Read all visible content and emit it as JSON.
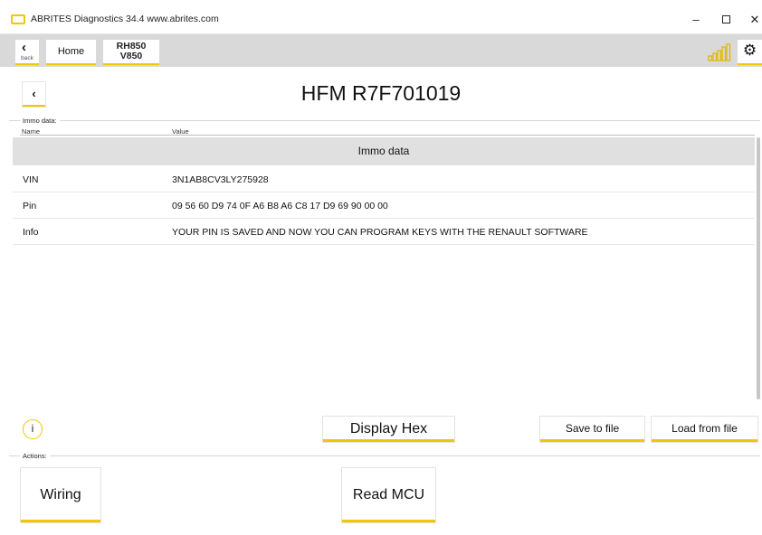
{
  "window": {
    "title": "ABRITES Diagnostics 34.4  www.abrites.com",
    "minimize": "–",
    "close": "✕"
  },
  "toolbar": {
    "back_chevron": "‹",
    "back_label": "back",
    "home_label": "Home",
    "module_line1": "RH850",
    "module_line2": "V850",
    "settings_icon": "⚙"
  },
  "header": {
    "back_chevron": "‹",
    "title": "HFM R7F701019"
  },
  "immo": {
    "group_label": "Immo data:",
    "col_name": "Name",
    "col_value": "Value",
    "section_header": "Immo data",
    "rows": [
      {
        "name": "VIN",
        "value": "3N1AB8CV3LY275928"
      },
      {
        "name": "Pin",
        "value": "09 56 60 D9 74 0F A6 B8 A6 C8 17 D9 69 90 00 00"
      },
      {
        "name": "Info",
        "value": "YOUR PIN IS SAVED AND NOW YOU CAN PROGRAM KEYS WITH THE RENAULT SOFTWARE"
      }
    ]
  },
  "controls": {
    "info_icon": "i",
    "display_hex": "Display Hex",
    "save_to_file": "Save to file",
    "load_from_file": "Load from file"
  },
  "actions": {
    "group_label": "Actions:",
    "wiring": "Wiring",
    "read_mcu": "Read MCU"
  },
  "colors": {
    "accent": "#f0c800",
    "toolbar_bg": "#d9d9d9",
    "section_bg": "#e0e0e0"
  }
}
